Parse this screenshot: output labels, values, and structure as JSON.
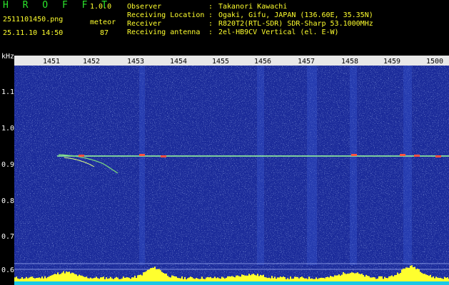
{
  "header": {
    "logo": "H R O F F T",
    "version": "1.0.0",
    "file_name": "2511101450.png",
    "mode": "meteor",
    "datetime": "25.11.10 14:50",
    "count": "87",
    "info": [
      {
        "label": "Observer",
        "value": "Takanori Kawachi"
      },
      {
        "label": "Receiving Location",
        "value": "Ogaki, Gifu, JAPAN (136.60E, 35.35N)"
      },
      {
        "label": "Receiver",
        "value": "R820T2(RTL-SDR) SDR-Sharp 53.1000MHz"
      },
      {
        "label": "Receiving antenna",
        "value": "2el-HB9CV Vertical (el. E-W)"
      }
    ],
    "colon": ":"
  },
  "spectrogram": {
    "y_unit": "kHz",
    "y_labels": [
      "1.1",
      "1.0",
      "0.9",
      "0.8",
      "0.7",
      "0.6"
    ],
    "x_labels": [
      "1451",
      "1452",
      "1453",
      "1454",
      "1455",
      "1456",
      "1457",
      "1458",
      "1459",
      "1500"
    ],
    "colors": {
      "background": "#1b2b9a",
      "trace": "#9cff9c",
      "time_bar": "#ffff2e",
      "baseline": "#1ac8e6"
    }
  }
}
